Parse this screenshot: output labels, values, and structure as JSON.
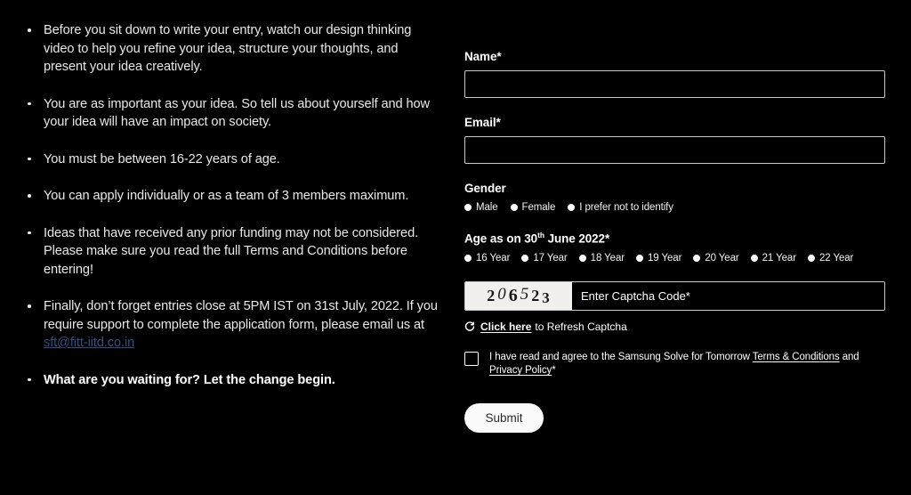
{
  "left": {
    "bullets": [
      {
        "text": "Before you sit down to write your entry, watch our design thinking video to help you refine your idea, structure your thoughts, and present your idea creatively.",
        "bold": false
      },
      {
        "text": "You are as important as your idea. So tell us about yourself and how your idea will have an impact on society.",
        "bold": false
      },
      {
        "text": "You must be between 16-22 years of age.",
        "bold": false
      },
      {
        "text": "You can apply individually or as a team of 3 members maximum.",
        "bold": false
      },
      {
        "text": "Ideas that have received any prior funding may not be considered. Please make sure you read the full Terms and Conditions before entering!",
        "bold": false
      }
    ],
    "final_bullet": {
      "prefix": "Finally, don’t forget entries close at 5PM IST on 31st July, 2022. If you require support to complete the application form, please email us at ",
      "email": "sft@fitt-iitd.co.in",
      "email_color": "#2e4f82"
    },
    "closing_bullet": "What are you waiting for? Let the change begin."
  },
  "form": {
    "name": {
      "label": "Name*",
      "value": "",
      "placeholder": ""
    },
    "email": {
      "label": "Email*",
      "value": "",
      "placeholder": ""
    },
    "gender": {
      "label": "Gender",
      "options": [
        "Male",
        "Female",
        "I prefer not to identify"
      ]
    },
    "age": {
      "label_prefix": "Age as on 30",
      "label_sup": "th",
      "label_suffix": " June 2022*",
      "options": [
        "16 Year",
        "17 Year",
        "18 Year",
        "19 Year",
        "20 Year",
        "21 Year",
        "22 Year"
      ]
    },
    "captcha": {
      "code": "206523",
      "digits": [
        "2",
        "0",
        "6",
        "5",
        "2",
        "3"
      ],
      "input_value": "",
      "input_placeholder": "Enter Captcha Code*",
      "refresh_link": "Click here",
      "refresh_tail": "to Refresh Captcha",
      "refresh_icon": "refresh-icon"
    },
    "terms": {
      "checked": false,
      "intro": "I have read and agree to the Samsung Solve for Tomorrow ",
      "link1": "Terms & Conditions",
      "conjunction": " and ",
      "link2": "Privacy Policy",
      "asterisk": "*"
    },
    "submit_label": "Submit"
  },
  "colors": {
    "background": "#000000",
    "text": "#ffffff",
    "border": "#c8c8c8",
    "link": "#2e4f82",
    "captcha_bg": "#f2f0ec",
    "submit_bg": "#fafafa"
  }
}
